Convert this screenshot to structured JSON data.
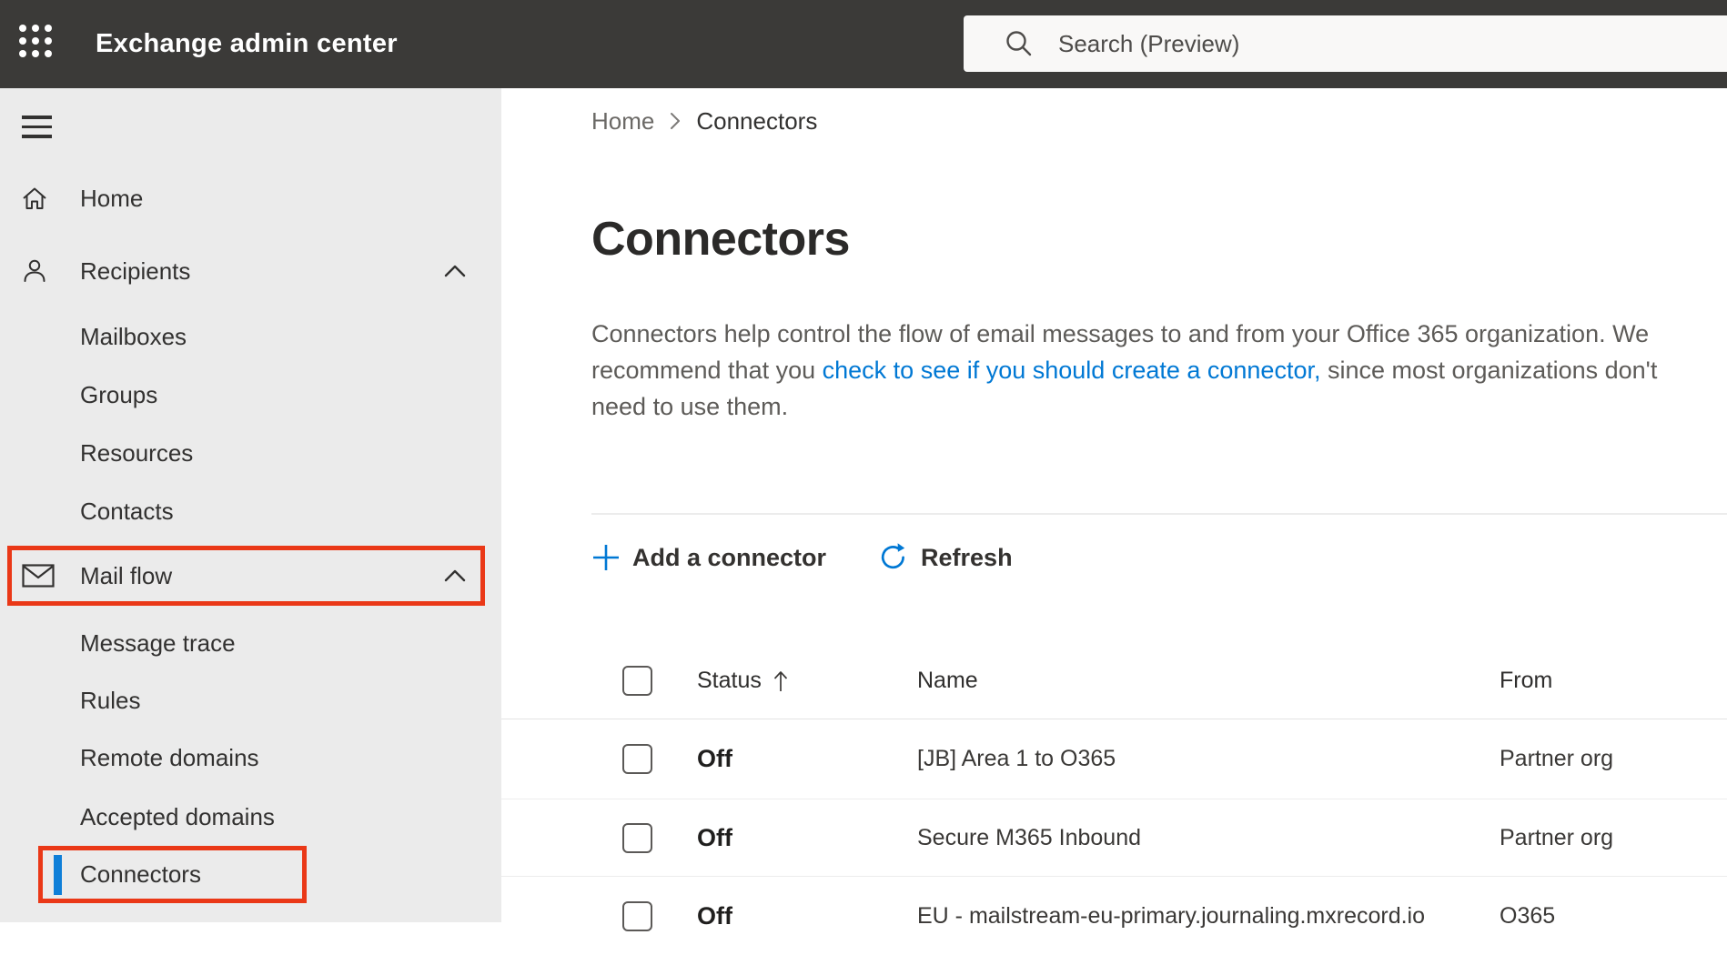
{
  "topbar": {
    "title": "Exchange admin center",
    "search_placeholder": "Search (Preview)"
  },
  "sidebar": {
    "items": [
      {
        "label": "Home",
        "icon": "home-icon",
        "level": 0
      },
      {
        "label": "Recipients",
        "icon": "person-icon",
        "level": 0,
        "expanded": true
      },
      {
        "label": "Mailboxes",
        "level": 1
      },
      {
        "label": "Groups",
        "level": 1
      },
      {
        "label": "Resources",
        "level": 1
      },
      {
        "label": "Contacts",
        "level": 1
      },
      {
        "label": "Mail flow",
        "icon": "mail-icon",
        "level": 0,
        "expanded": true,
        "annotated": true
      },
      {
        "label": "Message trace",
        "level": 1
      },
      {
        "label": "Rules",
        "level": 1
      },
      {
        "label": "Remote domains",
        "level": 1
      },
      {
        "label": "Accepted domains",
        "level": 1
      },
      {
        "label": "Connectors",
        "level": 1,
        "selected": true,
        "annotated": true
      }
    ]
  },
  "breadcrumb": {
    "root": "Home",
    "current": "Connectors"
  },
  "page": {
    "title": "Connectors",
    "description": {
      "before_link": "Connectors help control the flow of email messages to and from your Office 365 organization. We recommend that you ",
      "link_text": "check to see if you should create a connector,",
      "after_link": " since most organizations don't need to use them."
    }
  },
  "toolbar": {
    "add_label": "Add a connector",
    "refresh_label": "Refresh"
  },
  "table": {
    "headers": {
      "status": "Status",
      "name": "Name",
      "from": "From"
    },
    "sort_direction": "ascending",
    "rows": [
      {
        "status": "Off",
        "name": "[JB] Area 1 to O365",
        "from": "Partner org"
      },
      {
        "status": "Off",
        "name": "Secure M365 Inbound",
        "from": "Partner org"
      },
      {
        "status": "Off",
        "name": "EU - mailstream-eu-primary.journaling.mxrecord.io",
        "from": "O365"
      }
    ]
  },
  "colors": {
    "topbar_bg": "#3b3a38",
    "sidebar_bg": "#ebebeb",
    "annotation_red": "#ea3817",
    "selection_blue": "#0f7fd8",
    "link_blue": "#0078d4"
  }
}
